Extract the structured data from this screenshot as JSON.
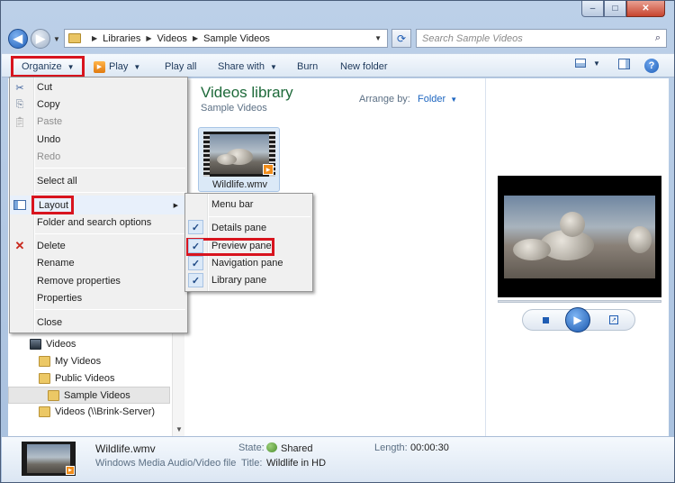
{
  "window": {
    "minimize_glyph": "–",
    "maximize_glyph": "□",
    "close_glyph": "✕"
  },
  "address": {
    "crumbs": [
      "Libraries",
      "Videos",
      "Sample Videos"
    ],
    "search_placeholder": "Search Sample Videos",
    "refresh_glyph": "⟳"
  },
  "toolbar": {
    "organize": "Organize",
    "play": "Play",
    "play_all": "Play all",
    "share_with": "Share with",
    "burn": "Burn",
    "new_folder": "New folder",
    "help_glyph": "?"
  },
  "navigation": {
    "items": [
      {
        "label": "Videos",
        "icon": "video-library-icon"
      },
      {
        "label": "My Videos",
        "icon": "folder-icon"
      },
      {
        "label": "Public Videos",
        "icon": "folder-icon"
      },
      {
        "label": "Sample Videos",
        "icon": "folder-icon",
        "selected": true
      },
      {
        "label": "Videos (\\\\Brink-Server)",
        "icon": "folder-icon"
      }
    ]
  },
  "library": {
    "title": "Videos library",
    "subtitle": "Sample Videos",
    "arrange_by_label": "Arrange by:",
    "arrange_by_value": "Folder"
  },
  "files": [
    {
      "name": "Wildlife.wmv"
    }
  ],
  "organize_menu": {
    "items": [
      {
        "label": "Cut",
        "icon": "scissors-icon",
        "enabled": true
      },
      {
        "label": "Copy",
        "icon": "copy-icon",
        "enabled": true
      },
      {
        "label": "Paste",
        "icon": "paste-icon",
        "enabled": false
      },
      {
        "label": "Undo",
        "enabled": true
      },
      {
        "label": "Redo",
        "enabled": false
      },
      {
        "label": "Select all",
        "enabled": true
      },
      {
        "label": "Layout",
        "icon": "layout-icon",
        "enabled": true,
        "has_submenu": true
      },
      {
        "label": "Folder and search options",
        "enabled": true
      },
      {
        "label": "Delete",
        "icon": "delete-icon",
        "enabled": true
      },
      {
        "label": "Rename",
        "enabled": true
      },
      {
        "label": "Remove properties",
        "enabled": true
      },
      {
        "label": "Properties",
        "enabled": true
      },
      {
        "label": "Close",
        "enabled": true
      }
    ]
  },
  "layout_submenu": {
    "items": [
      {
        "label": "Menu bar",
        "checked": false
      },
      {
        "label": "Details pane",
        "checked": true
      },
      {
        "label": "Preview pane",
        "checked": true
      },
      {
        "label": "Navigation pane",
        "checked": true
      },
      {
        "label": "Library pane",
        "checked": true
      }
    ]
  },
  "details": {
    "file_name": "Wildlife.wmv",
    "file_type": "Windows Media Audio/Video file",
    "state_label": "State:",
    "state_value": "Shared",
    "title_label": "Title:",
    "title_value": "Wildlife in HD",
    "length_label": "Length:",
    "length_value": "00:00:30"
  },
  "colors": {
    "highlight_red": "#d8141e",
    "library_title_green": "#1e6a3a",
    "link_blue": "#1e66c0"
  }
}
